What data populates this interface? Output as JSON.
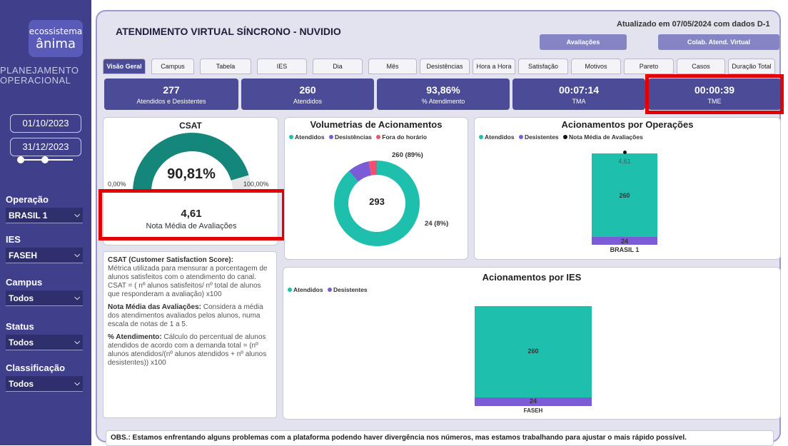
{
  "sidebar": {
    "logo_line1": "ecossistema",
    "logo_line2": "ânima",
    "brand_line1": "PLANEJAMENTO",
    "brand_line2": "OPERACIONAL",
    "date_start": "01/10/2023",
    "date_end": "31/12/2023",
    "filters": [
      {
        "label": "Operação",
        "value": "BRASIL 1"
      },
      {
        "label": "IES",
        "value": "FASEH"
      },
      {
        "label": "Campus",
        "value": "Todos"
      },
      {
        "label": "Status",
        "value": "Todos"
      },
      {
        "label": "Classificação",
        "value": "Todos"
      }
    ]
  },
  "header": {
    "title": "ATENDIMENTO VIRTUAL SÍNCRONO - NUVIDIO",
    "updated": "Atualizado em 07/05/2024 com dados D-1",
    "btn_avaliacoes": "Avaliações",
    "btn_colab": "Colab. Atend. Virtual"
  },
  "tabs": [
    "Visão Geral",
    "Campus",
    "Tabela",
    "IES",
    "Dia",
    "Mês",
    "Desistências",
    "Hora a Hora",
    "Satisfação",
    "Motivos",
    "Pareto",
    "Casos",
    "Duração Total"
  ],
  "active_tab": "Visão Geral",
  "kpis": [
    {
      "value": "277",
      "caption": "Atendidos e Desistentes"
    },
    {
      "value": "260",
      "caption": "Atendidos"
    },
    {
      "value": "93,86%",
      "caption": "% Atendimento"
    },
    {
      "value": "00:07:14",
      "caption": "TMA"
    },
    {
      "value": "00:00:39",
      "caption": "TME"
    }
  ],
  "csat": {
    "title": "CSAT",
    "value_text": "90,81%",
    "value": 0.9081,
    "min_label": "0,00%",
    "max_label": "100,00%",
    "avg_value": "4,61",
    "avg_label": "Nota Média de Avaliações"
  },
  "descriptions": {
    "csat_head": "CSAT (Customer Satisfaction Score):",
    "csat_body": "Métrica utilizada para mensurar a porcentagem de alunos satisfeitos com o atendimento do canal.",
    "csat_formula": "CSAT = ( nº alunos satisfeitos/ nº total de alunos que responderam a avaliação) x100",
    "nota_head": "Nota Média das Avaliações:",
    "nota_body": "Considera a média dos atendimentos avaliados pelos alunos, numa escala de notas de 1 a 5.",
    "atend_head": "% Atendimento:",
    "atend_body": "Cálculo do percentual de alunos atendidos de acordo com a demanda total = (nº alunos atendidos/(nº alunos atendidos + nº alunos desistentes)) x100"
  },
  "volumetrias": {
    "title": "Volumetrias de Acionamentos",
    "legend": [
      "Atendidos",
      "Desistências",
      "Fora do horário"
    ],
    "center": "293",
    "label_main": "260 (89%)",
    "label_small": "24 (8%)"
  },
  "operacoes": {
    "title": "Acionamentos por Operações",
    "legend": [
      "Atendidos",
      "Desistentes",
      "Nota Média de Avaliações"
    ],
    "avg": "4,61",
    "v_atendidos": "260",
    "v_desist": "24",
    "category": "BRASIL 1"
  },
  "ies": {
    "title": "Acionamentos por IES",
    "legend": [
      "Atendidos",
      "Desistentes"
    ],
    "v_atendidos": "260",
    "v_desist": "24",
    "category": "FASEH"
  },
  "chart_data": [
    {
      "type": "pie",
      "title": "Volumetrias de Acionamentos",
      "categories": [
        "Atendidos",
        "Desistências",
        "Fora do horário"
      ],
      "values": [
        260,
        24,
        9
      ],
      "total": 293
    },
    {
      "type": "bar",
      "title": "Acionamentos por Operações",
      "categories": [
        "BRASIL 1"
      ],
      "series": [
        {
          "name": "Atendidos",
          "values": [
            260
          ]
        },
        {
          "name": "Desistentes",
          "values": [
            24
          ]
        }
      ],
      "avg": 4.61
    },
    {
      "type": "bar",
      "title": "Acionamentos por IES",
      "categories": [
        "FASEH"
      ],
      "series": [
        {
          "name": "Atendidos",
          "values": [
            260
          ]
        },
        {
          "name": "Desistentes",
          "values": [
            24
          ]
        }
      ]
    }
  ],
  "obs": "OBS.: Estamos enfrentando alguns problemas com a plataforma podendo haver divergência nos números, mas estamos trabalhando para ajustar o mais rápido possível.",
  "colors": {
    "teal": "#1fbfae",
    "purple": "#7b5bd6",
    "red": "#f0506e",
    "navy": "#4b4b97",
    "gauge": "#14877a"
  }
}
